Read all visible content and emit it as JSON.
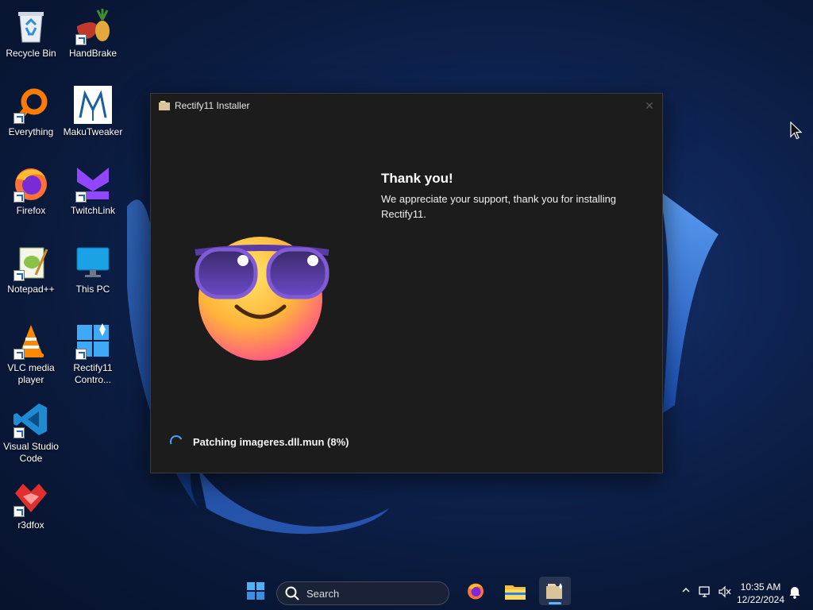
{
  "desktop": {
    "icons": [
      {
        "label": "Recycle Bin",
        "icon": "recycle-bin-icon"
      },
      {
        "label": "HandBrake",
        "icon": "handbrake-icon"
      },
      {
        "label": "Everything",
        "icon": "everything-search-icon"
      },
      {
        "label": "MakuTweaker",
        "icon": "makutweaker-icon"
      },
      {
        "label": "Firefox",
        "icon": "firefox-icon"
      },
      {
        "label": "TwitchLink",
        "icon": "twitchlink-icon"
      },
      {
        "label": "Notepad++",
        "icon": "notepad-plus-plus-icon"
      },
      {
        "label": "This PC",
        "icon": "this-pc-icon"
      },
      {
        "label": "VLC media player",
        "icon": "vlc-icon"
      },
      {
        "label": "Rectify11 Contro...",
        "icon": "rectify11-control-icon"
      },
      {
        "label": "Visual Studio Code",
        "icon": "vscode-icon"
      },
      {
        "label": "r3dfox",
        "icon": "r3dfox-icon"
      }
    ]
  },
  "installer": {
    "title": "Rectify11 Installer",
    "close_glyph": "✕",
    "heading": "Thank you!",
    "message": "We appreciate your support, thank you for installing Rectify11.",
    "status": "Patching imageres.dll.mun (8%)",
    "progress_percent": 8,
    "emoji": "smiling-face-with-sunglasses-icon"
  },
  "taskbar": {
    "search_placeholder": "Search",
    "apps": [
      "start-icon",
      "firefox-icon",
      "file-explorer-icon",
      "rectify11-installer-icon"
    ],
    "time": "10:35 AM",
    "date": "12/22/2024",
    "accent": "#5fb2ff"
  }
}
